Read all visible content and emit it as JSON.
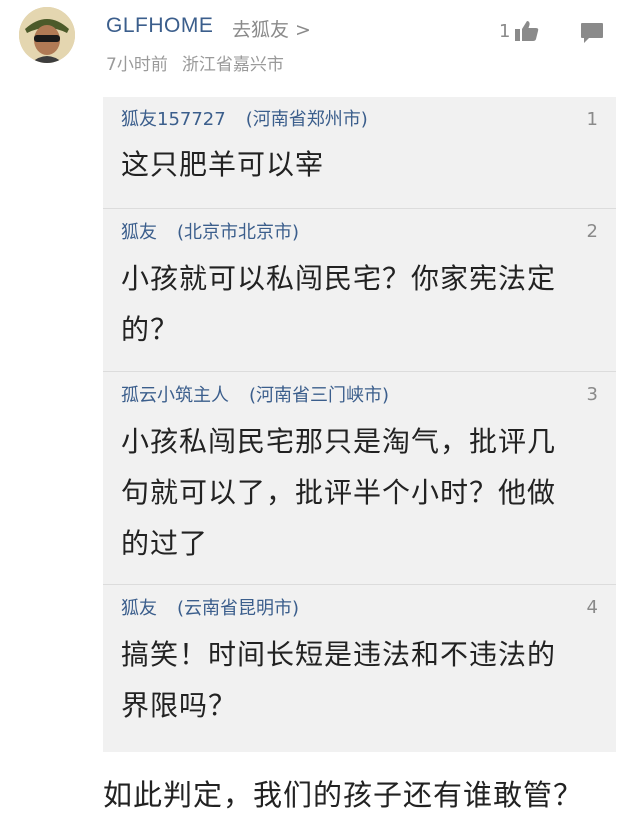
{
  "comment": {
    "user_name": "GLFHOME",
    "goto_link": "去狐友",
    "goto_chevron": ">",
    "time": "7小时前",
    "location": "浙江省嘉兴市",
    "like_count": "1",
    "like_icon": "thumbs-up-icon",
    "reply_icon": "comment-bubble-icon"
  },
  "replies": [
    {
      "user": "狐友157727",
      "location": "(河南省郑州市)",
      "floor": "1",
      "lines": [
        "这只肥羊可以宰"
      ]
    },
    {
      "user": "狐友",
      "location": "(北京市北京市)",
      "floor": "2",
      "lines": [
        "小孩就可以私闯民宅？你家宪法定",
        "的？"
      ]
    },
    {
      "user": "孤云小筑主人",
      "location": "(河南省三门峡市)",
      "floor": "3",
      "lines": [
        "小孩私闯民宅那只是淘气，批评几",
        "句就可以了，批评半个小时？他做",
        "的过了"
      ]
    },
    {
      "user": "狐友",
      "location": "(云南省昆明市)",
      "floor": "4",
      "lines": [
        "搞笑！时间长短是违法和不违法的",
        "界限吗？"
      ]
    }
  ],
  "footer_text": "如此判定，我们的孩子还有谁敢管？",
  "colors": {
    "link": "#3b5e8c",
    "muted": "#8a8a8a",
    "reply_bg": "#f1f1f1",
    "text": "#222222"
  }
}
